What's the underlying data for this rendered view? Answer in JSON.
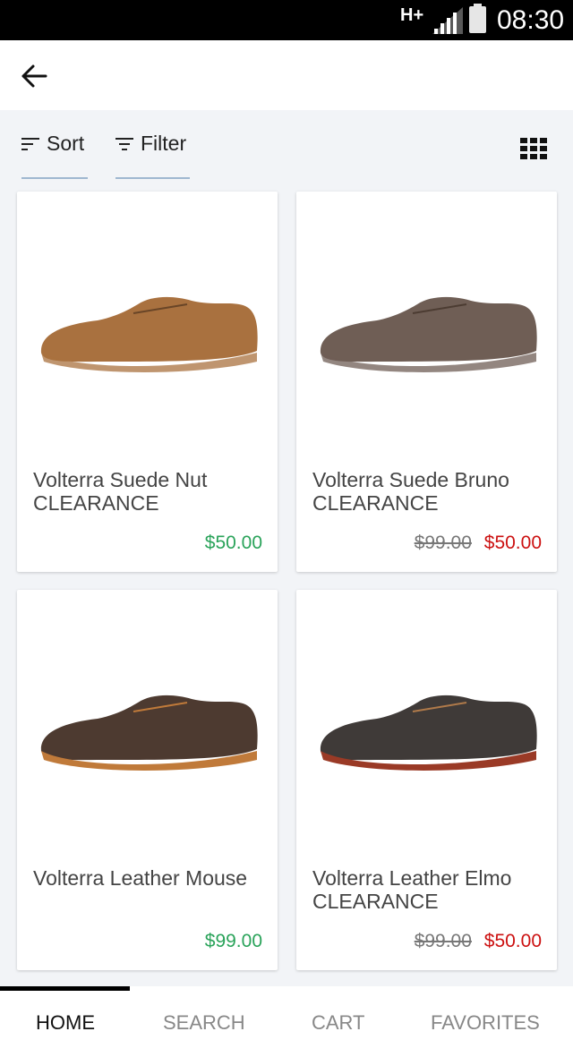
{
  "status_bar": {
    "network": "H+",
    "time": "08:30"
  },
  "toolbar": {
    "sort_label": "Sort",
    "filter_label": "Filter"
  },
  "products": [
    {
      "name": "Volterra Suede Nut CLEARANCE",
      "old_price": "",
      "price": "$50.00",
      "color": "#a9713f"
    },
    {
      "name": "Volterra Suede Bruno CLEARANCE",
      "old_price": "$99.00",
      "price": "$50.00",
      "color": "#6f5e55"
    },
    {
      "name": "Volterra Leather Mouse",
      "old_price": "",
      "price": "$99.00",
      "color": "#4d3a30"
    },
    {
      "name": "Volterra Leather Elmo CLEARANCE",
      "old_price": "$99.00",
      "price": "$50.00",
      "color": "#3f3a38"
    }
  ],
  "nav": {
    "home": "HOME",
    "search": "SEARCH",
    "cart": "CART",
    "favorites": "FAVORITES",
    "active": "home"
  }
}
